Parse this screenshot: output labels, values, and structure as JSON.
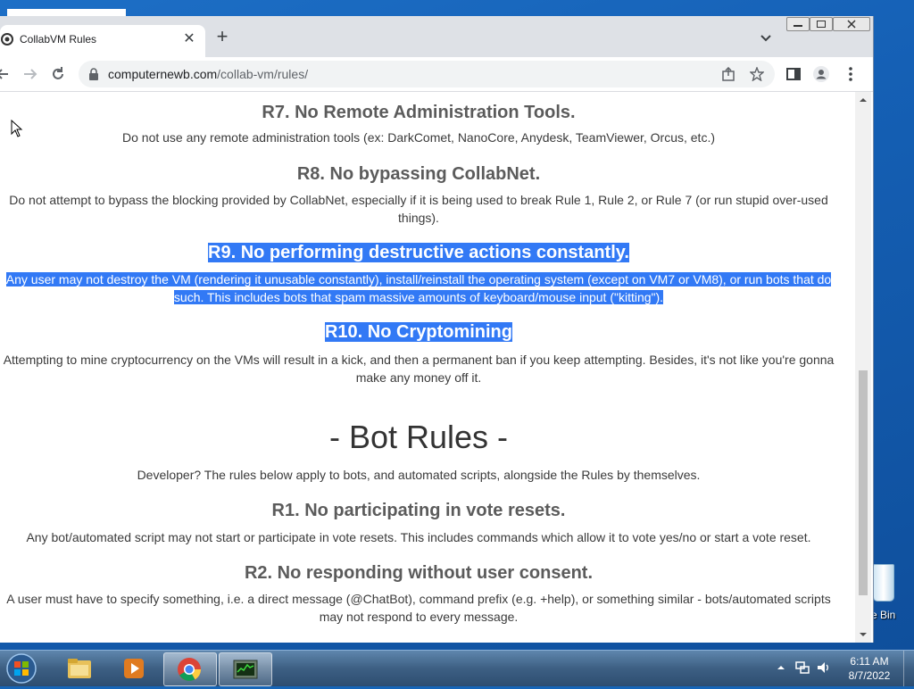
{
  "browser": {
    "tab": {
      "title": "CollabVM Rules",
      "close": "✕"
    },
    "new_tab": "+",
    "url_host": "computernewb.com",
    "url_path": "/collab-vm/rules/"
  },
  "page": {
    "r7": {
      "title": "R7. No Remote Administration Tools.",
      "text": "Do not use any remote administration tools (ex: DarkComet, NanoCore, Anydesk, TeamViewer, Orcus, etc.)"
    },
    "r8": {
      "title": "R8. No bypassing CollabNet.",
      "text_line1": "Do not attempt to bypass the blocking provided by CollabNet, especially if it is being used to break Rule 1, Rule 2, or Rule 7 (or run stupid over-used",
      "text_line2": "things)."
    },
    "r9": {
      "title": "R9. No performing destructive actions constantly.",
      "text_line1": "Any user may not destroy the VM (rendering it unusable constantly), install/reinstall the operating system (except on VM7 or VM8), or run bots that do",
      "text_line2": "such. This includes bots that spam massive amounts of keyboard/mouse input (\"kitting\")."
    },
    "r10": {
      "title": "R10. No Cryptomining",
      "text_line1": "Attempting to mine cryptocurrency on the VMs will result in a kick, and then a permanent ban if you keep attempting. Besides, it's not like you're gonna",
      "text_line2": "make any money off it."
    },
    "bot_rules": {
      "title": "- Bot Rules -",
      "intro": "Developer? The rules below apply to bots, and automated scripts, alongside the Rules by themselves."
    },
    "b1": {
      "title": "R1. No participating in vote resets.",
      "text": "Any bot/automated script may not start or participate in vote resets. This includes commands which allow it to vote yes/no or start a vote reset."
    },
    "b2": {
      "title": "R2. No responding without user consent.",
      "text_line1": "A user must have to specify something, i.e. a direct message (@ChatBot), command prefix (e.g. +help), or something similar - bots/automated scripts",
      "text_line2": "may not respond to every message."
    }
  },
  "desktop": {
    "recycle_bin_label": "e Bin"
  },
  "taskbar": {
    "time": "6:11 AM",
    "date": "8/7/2022"
  },
  "colors": {
    "selection": "#3279f5",
    "taskbar": "#3d5f83"
  }
}
